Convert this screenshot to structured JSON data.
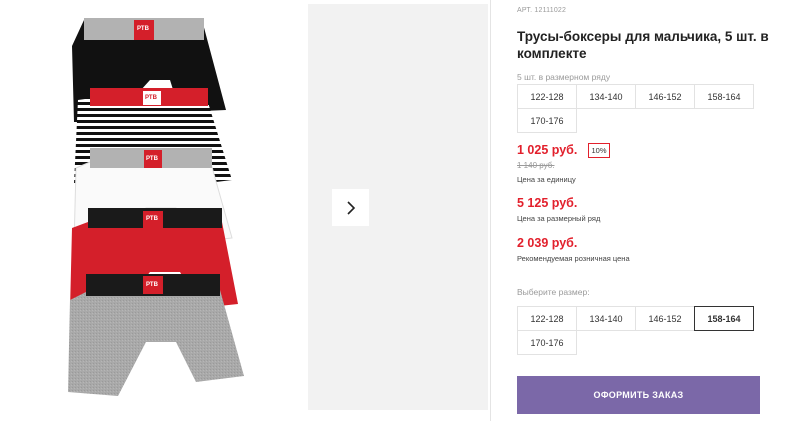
{
  "product": {
    "sku": "АРТ. 12111022",
    "title": "Трусы-боксеры для мальчика, 5 шт. в комплекте",
    "image_label": "РТВ",
    "row_hint": "5 шт. в размерном ряду",
    "row_sizes": [
      "122-128",
      "134-140",
      "146-152",
      "158-164",
      "170-176"
    ],
    "price_unit": "1 025 руб.",
    "discount": "10%",
    "price_old": "1 140 руб.",
    "price_unit_caption": "Цена за единицу",
    "price_row": "5 125 руб.",
    "price_row_caption": "Цена за размерный ряд",
    "price_retail": "2 039 руб.",
    "price_retail_caption": "Рекомендуемая розничная цена",
    "select_size_label": "Выберите размер:",
    "selectable_sizes": [
      "122-128",
      "134-140",
      "146-152",
      "158-164",
      "170-176"
    ],
    "selected_size": "158-164",
    "order_button": "ОФОРМИТЬ ЗАКАЗ"
  },
  "colors": {
    "price_red": "#e2202c",
    "button_purple": "#7b68a8"
  },
  "icons": {
    "next": "chevron-right-icon"
  }
}
